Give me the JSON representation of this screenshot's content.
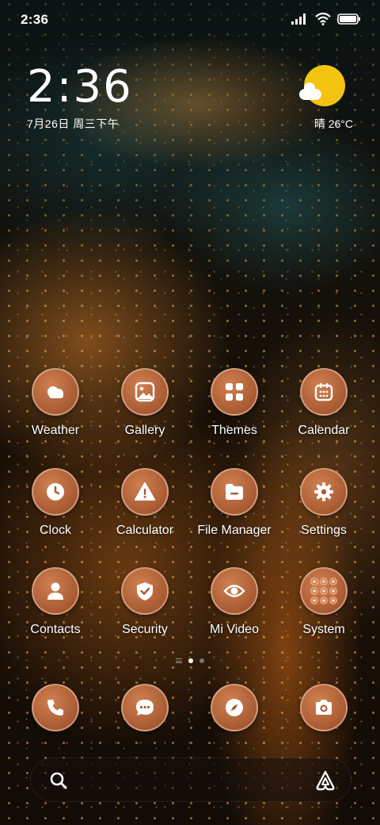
{
  "status_bar": {
    "time": "2:36"
  },
  "clock_widget": {
    "time": "2:36",
    "date": "7月26日 周三下午"
  },
  "weather_widget": {
    "condition_temp": "晴 26°C"
  },
  "apps": [
    {
      "label": "Weather",
      "icon": "cloud-icon"
    },
    {
      "label": "Gallery",
      "icon": "image-icon"
    },
    {
      "label": "Themes",
      "icon": "grid-icon"
    },
    {
      "label": "Calendar",
      "icon": "calendar-icon"
    },
    {
      "label": "Clock",
      "icon": "clock-icon"
    },
    {
      "label": "Calculator",
      "icon": "warning-icon"
    },
    {
      "label": "File Manager",
      "icon": "folder-icon"
    },
    {
      "label": "Settings",
      "icon": "gear-icon"
    },
    {
      "label": "Contacts",
      "icon": "person-icon"
    },
    {
      "label": "Security",
      "icon": "shield-icon"
    },
    {
      "label": "Mi Video",
      "icon": "eye-icon"
    },
    {
      "label": "System",
      "icon": "folder-grid-icon"
    }
  ],
  "dock": [
    {
      "icon": "phone-icon"
    },
    {
      "icon": "message-icon"
    },
    {
      "icon": "compass-icon"
    },
    {
      "icon": "camera-icon"
    }
  ],
  "page_indicator": {
    "pages": 2,
    "current": 1
  },
  "colors": {
    "icon_fill": "#a85a33",
    "sun": "#f2c40f"
  }
}
